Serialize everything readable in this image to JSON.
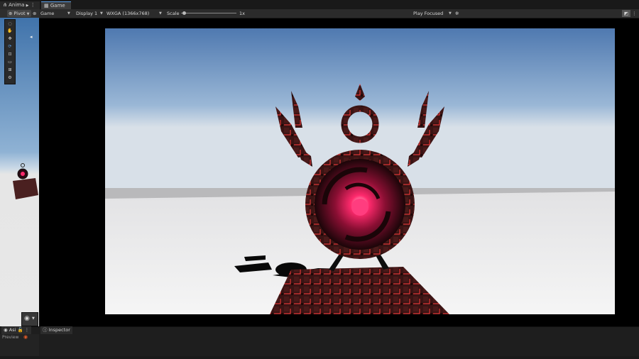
{
  "tabs": {
    "animation": "Anima",
    "game": "Game"
  },
  "game_toolbar": {
    "view_select": "Game",
    "display_select": "Display 1",
    "resolution_select": "WXGA (1366x768)",
    "scale_label": "Scale",
    "scale_slider_value": 0.02,
    "scale_value": "1x",
    "play_mode_select": "Play Focused"
  },
  "scene_toolbar": {
    "pivot_select": "Pivot"
  },
  "bottom_tabs": {
    "asset": "Asi",
    "inspector": "Inspector",
    "preview": "Preview"
  },
  "colors": {
    "accent": "#5a9ee6",
    "sky_top": "#4f79b0",
    "glow": "#ff2a6d",
    "frame_black": "#000000"
  }
}
